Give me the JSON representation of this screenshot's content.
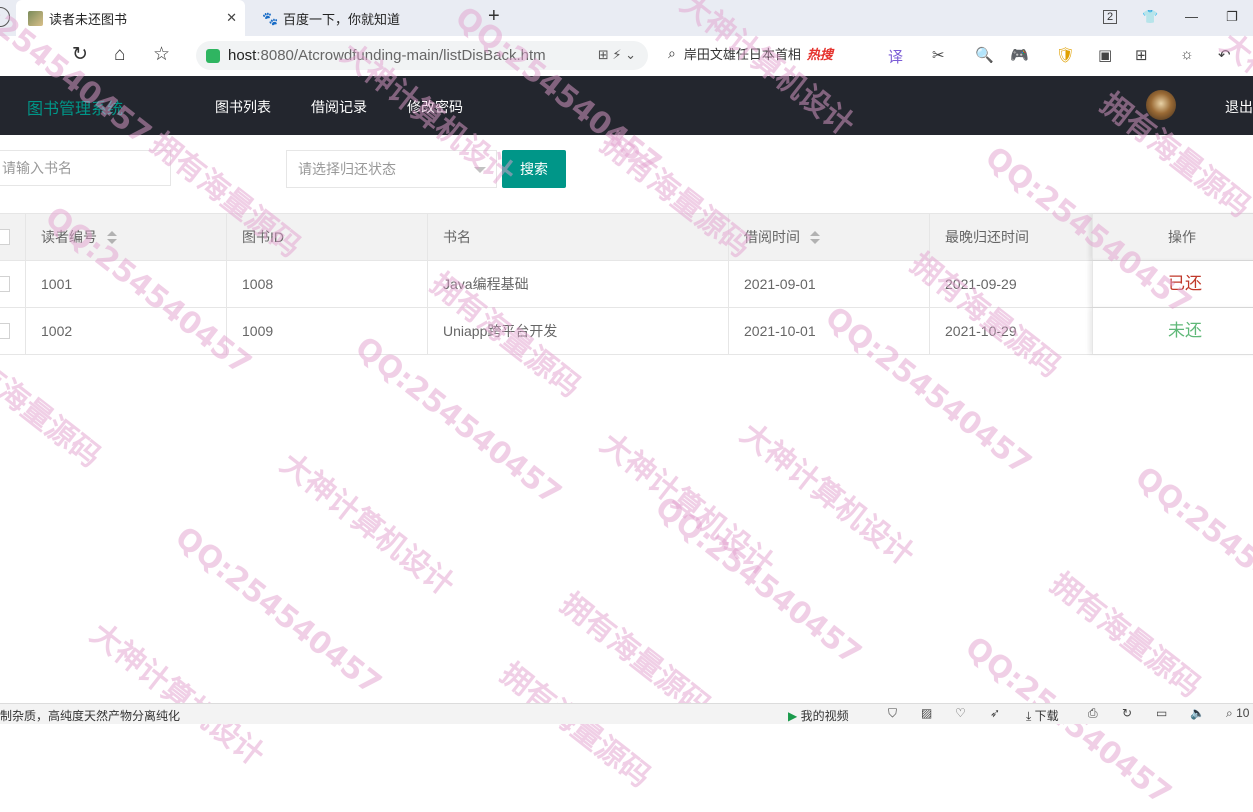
{
  "browser": {
    "tabs": [
      {
        "title": "读者未还图书",
        "active": true
      },
      {
        "title": "百度一下，你就知道",
        "active": false
      }
    ],
    "url_host": "host",
    "url_rest": ":8080/Atcrowdfunding-main/listDisBack.htm",
    "search_suggestion": "岸田文雄任日本首相",
    "search_hot": "热搜",
    "tab_count": "2",
    "status_left": "制杂质，高纯度天然产物分离纯化",
    "status_video": "我的视频",
    "status_download": "下载",
    "status_zoom": "10"
  },
  "app": {
    "title": "图书管理系统",
    "nav": [
      "图书列表",
      "借阅记录",
      "修改密码"
    ],
    "logout": "退出"
  },
  "search": {
    "book_placeholder": "请输入书名",
    "status_placeholder": "请选择归还状态",
    "button": "搜索"
  },
  "table": {
    "headers": [
      "读者编号",
      "图书ID",
      "书名",
      "借阅时间",
      "最晚归还时间",
      "操作"
    ],
    "rows": [
      {
        "reader_id": "1001",
        "book_id": "1008",
        "book_name": "Java编程基础",
        "borrow_time": "2021-09-01",
        "due_time": "2021-09-29",
        "status": "已还",
        "status_color": "#c0392b"
      },
      {
        "reader_id": "1002",
        "book_id": "1009",
        "book_name": "Uniapp跨平台开发",
        "borrow_time": "2021-10-01",
        "due_time": "2021-10-29",
        "status": "未还",
        "status_color": "#5fb878"
      }
    ]
  },
  "watermark": [
    "QQ:254540457",
    "拥有海量源码",
    "大神计算机设计"
  ],
  "colors": {
    "header_bg": "#23262e",
    "accent": "#009688"
  }
}
